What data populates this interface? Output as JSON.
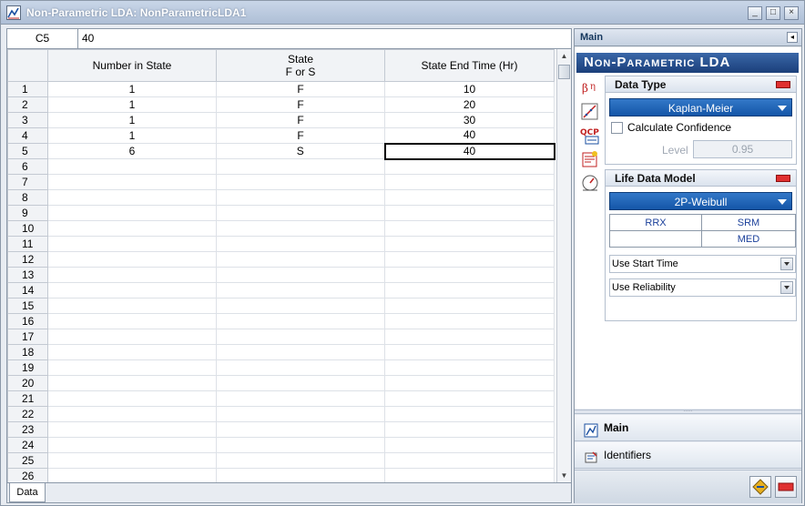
{
  "window": {
    "title": "Non-Parametric LDA: NonParametricLDA1"
  },
  "cellbar": {
    "cell_ref": "C5",
    "cell_value": "40"
  },
  "grid": {
    "columns": [
      "Number in State",
      "State\nF or S",
      "State End Time (Hr)"
    ],
    "rows": [
      {
        "n": "1",
        "number": "1",
        "state": "F",
        "time": "10"
      },
      {
        "n": "2",
        "number": "1",
        "state": "F",
        "time": "20"
      },
      {
        "n": "3",
        "number": "1",
        "state": "F",
        "time": "30"
      },
      {
        "n": "4",
        "number": "1",
        "state": "F",
        "time": "40"
      },
      {
        "n": "5",
        "number": "6",
        "state": "S",
        "time": "40"
      },
      {
        "n": "6",
        "number": "",
        "state": "",
        "time": ""
      },
      {
        "n": "7",
        "number": "",
        "state": "",
        "time": ""
      },
      {
        "n": "8",
        "number": "",
        "state": "",
        "time": ""
      },
      {
        "n": "9",
        "number": "",
        "state": "",
        "time": ""
      },
      {
        "n": "10",
        "number": "",
        "state": "",
        "time": ""
      },
      {
        "n": "11",
        "number": "",
        "state": "",
        "time": ""
      },
      {
        "n": "12",
        "number": "",
        "state": "",
        "time": ""
      },
      {
        "n": "13",
        "number": "",
        "state": "",
        "time": ""
      },
      {
        "n": "14",
        "number": "",
        "state": "",
        "time": ""
      },
      {
        "n": "15",
        "number": "",
        "state": "",
        "time": ""
      },
      {
        "n": "16",
        "number": "",
        "state": "",
        "time": ""
      },
      {
        "n": "17",
        "number": "",
        "state": "",
        "time": ""
      },
      {
        "n": "18",
        "number": "",
        "state": "",
        "time": ""
      },
      {
        "n": "19",
        "number": "",
        "state": "",
        "time": ""
      },
      {
        "n": "20",
        "number": "",
        "state": "",
        "time": ""
      },
      {
        "n": "21",
        "number": "",
        "state": "",
        "time": ""
      },
      {
        "n": "22",
        "number": "",
        "state": "",
        "time": ""
      },
      {
        "n": "23",
        "number": "",
        "state": "",
        "time": ""
      },
      {
        "n": "24",
        "number": "",
        "state": "",
        "time": ""
      },
      {
        "n": "25",
        "number": "",
        "state": "",
        "time": ""
      },
      {
        "n": "26",
        "number": "",
        "state": "",
        "time": ""
      }
    ],
    "selected_row": 5
  },
  "sheet_tabs": [
    "Data"
  ],
  "panel": {
    "header": "Main",
    "banner": "Non-Parametric LDA",
    "tool_icons": [
      "sigma-mu-icon",
      "plot-icon",
      "qcp-icon",
      "report-icon",
      "gauge-icon"
    ],
    "data_type": {
      "title": "Data Type",
      "selected": "Kaplan-Meier",
      "calc_confidence_label": "Calculate Confidence",
      "calc_confidence_checked": false,
      "level_label": "Level",
      "level_value": "0.95"
    },
    "life_data_model": {
      "title": "Life Data Model",
      "selected": "2P-Weibull",
      "options": {
        "rrx": "RRX",
        "srm": "SRM",
        "med": "MED"
      },
      "start_time": "Use Start Time",
      "reliability": "Use Reliability"
    },
    "nav": {
      "main": "Main",
      "identifiers": "Identifiers"
    }
  },
  "colors": {
    "banner": "#1b3f7a",
    "selector": "#1456a8",
    "toggle": "#e03030"
  }
}
